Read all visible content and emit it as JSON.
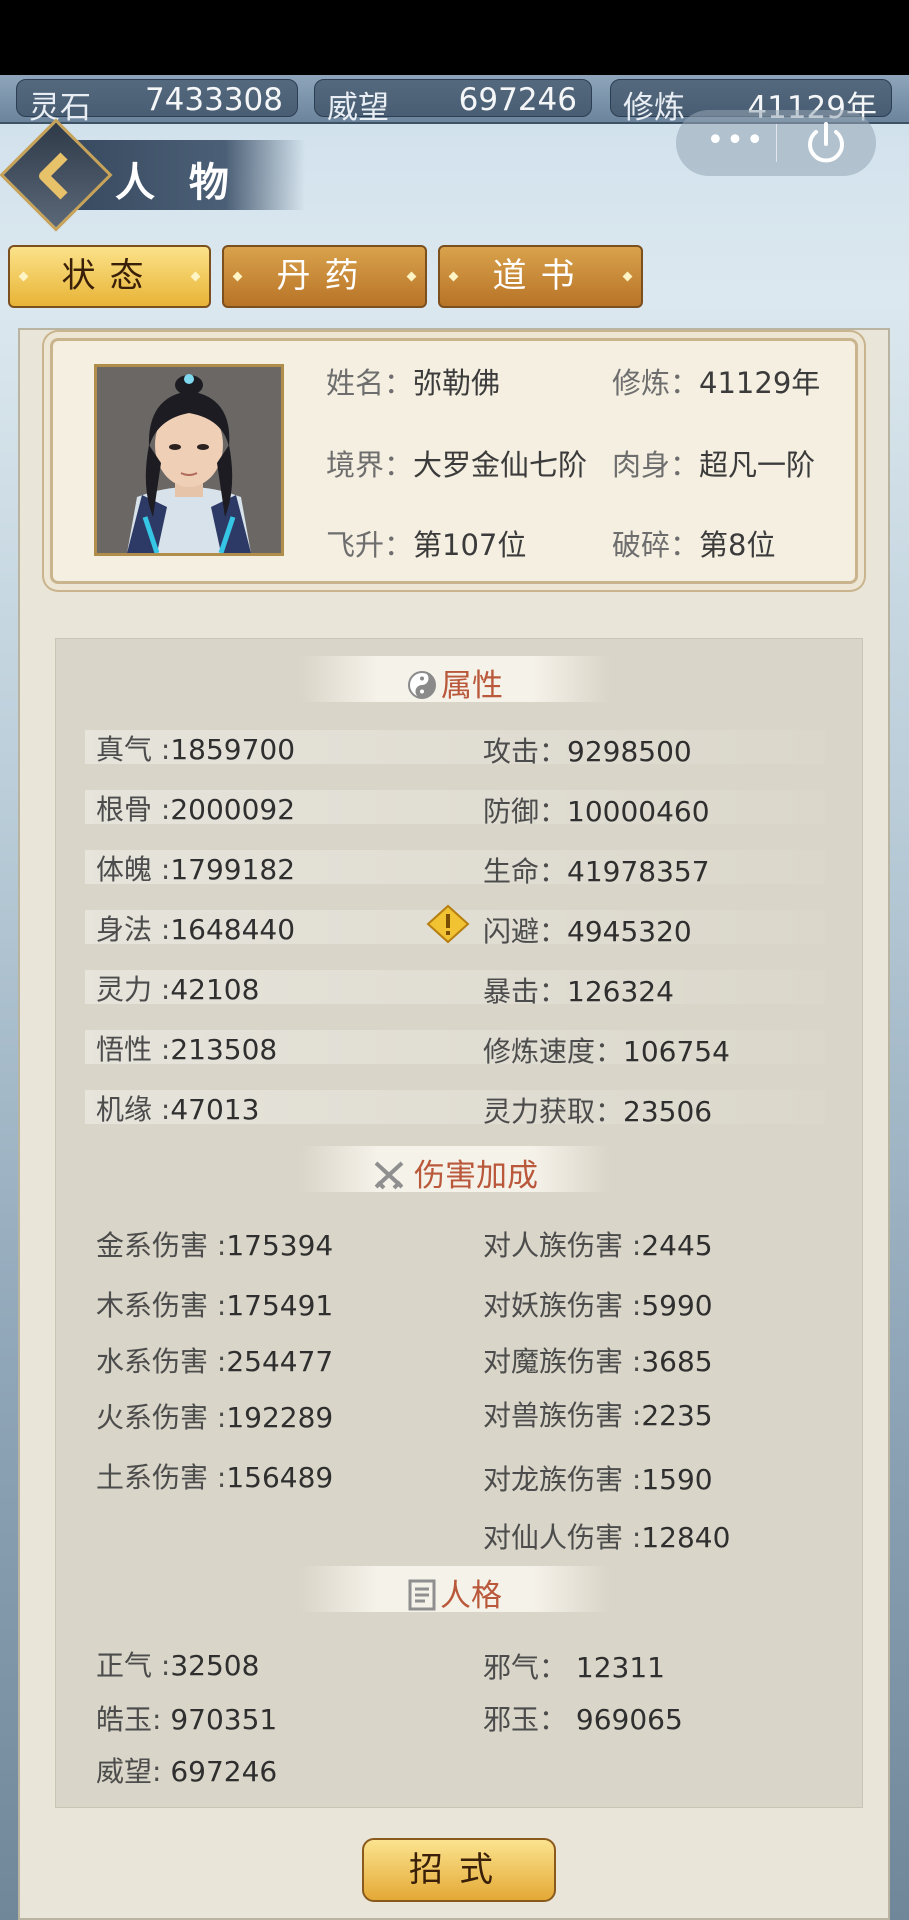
{
  "resources": [
    {
      "label": "灵石",
      "value": "7433308"
    },
    {
      "label": "威望",
      "value": "697246"
    },
    {
      "label": "修炼",
      "value": "41129年"
    }
  ],
  "title": "人 物",
  "capsule": {
    "more": "•••"
  },
  "tabs": [
    {
      "label": "状态",
      "active": true
    },
    {
      "label": "丹药",
      "active": false
    },
    {
      "label": "道书",
      "active": false
    }
  ],
  "profile": {
    "name_key": "姓名：",
    "name": "弥勒佛",
    "cultivation_key": "修炼：",
    "cultivation": "41129年",
    "realm_key": "境界：",
    "realm": "大罗金仙七阶",
    "body_key": "肉身：",
    "body": "超凡一阶",
    "ascend_key": "飞升：",
    "ascend": "第107位",
    "shatter_key": "破碎：",
    "shatter": "第8位"
  },
  "sections": {
    "attributes": "属性",
    "damage": "伤害加成",
    "personality": "人格"
  },
  "attributes": {
    "left": [
      {
        "k": "真气 :",
        "v": "1859700"
      },
      {
        "k": "根骨 :",
        "v": "2000092"
      },
      {
        "k": "体魄 :",
        "v": "1799182"
      },
      {
        "k": "身法 :",
        "v": "1648440"
      },
      {
        "k": "灵力 :",
        "v": "42108"
      },
      {
        "k": "悟性 :",
        "v": "213508"
      },
      {
        "k": "机缘 :",
        "v": "47013"
      }
    ],
    "right": [
      {
        "k": "攻击：",
        "v": "9298500"
      },
      {
        "k": "防御：",
        "v": "10000460"
      },
      {
        "k": "生命：",
        "v": "41978357"
      },
      {
        "k": "闪避：",
        "v": "4945320"
      },
      {
        "k": "暴击：",
        "v": "126324"
      },
      {
        "k": "修炼速度：",
        "v": "106754"
      },
      {
        "k": "灵力获取：",
        "v": "23506"
      }
    ]
  },
  "damage": {
    "left": [
      {
        "k": "金系伤害 :",
        "v": "175394"
      },
      {
        "k": "木系伤害 :",
        "v": "175491"
      },
      {
        "k": "水系伤害 :",
        "v": "254477"
      },
      {
        "k": "火系伤害 :",
        "v": "192289"
      },
      {
        "k": "土系伤害 :",
        "v": "156489"
      }
    ],
    "right": [
      {
        "k": "对人族伤害 :",
        "v": "2445"
      },
      {
        "k": "对妖族伤害 :",
        "v": "5990"
      },
      {
        "k": "对魔族伤害 :",
        "v": "3685"
      },
      {
        "k": "对兽族伤害 :",
        "v": "2235"
      },
      {
        "k": "对龙族伤害 :",
        "v": "1590"
      },
      {
        "k": "对仙人伤害 :",
        "v": "12840"
      }
    ]
  },
  "personality": {
    "left": [
      {
        "k": "正气 :",
        "v": "32508"
      },
      {
        "k": "皓玉: ",
        "v": "970351"
      },
      {
        "k": "威望: ",
        "v": "697246"
      }
    ],
    "right": [
      {
        "k": "邪气： ",
        "v": "12311"
      },
      {
        "k": "邪玉： ",
        "v": "969065"
      }
    ]
  },
  "skill_button": "招式"
}
